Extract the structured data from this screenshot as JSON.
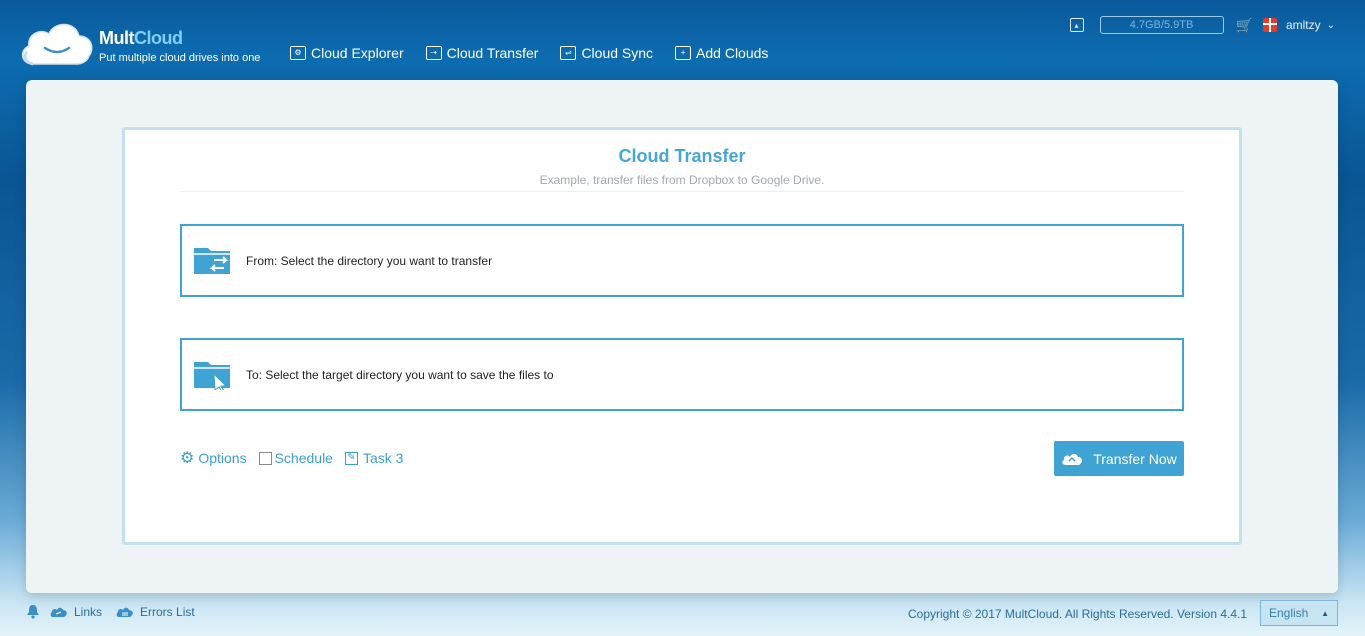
{
  "header": {
    "logo_name": "MultCloud",
    "logo_name_a": "Mult",
    "logo_name_b": "Cloud",
    "logo_tagline": "Put multiple cloud drives into one",
    "nav": [
      {
        "label": "Cloud Explorer",
        "icon": "explorer-icon"
      },
      {
        "label": "Cloud Transfer",
        "icon": "transfer-icon"
      },
      {
        "label": "Cloud Sync",
        "icon": "sync-icon"
      },
      {
        "label": "Add Clouds",
        "icon": "add-icon"
      }
    ],
    "storage": "4.7GB/5.9TB",
    "username": "amltzy"
  },
  "main": {
    "title": "Cloud Transfer",
    "subtitle": "Example, transfer files from Dropbox to Google Drive.",
    "from_text": "From: Select the directory you want to transfer",
    "to_text": "To: Select the target directory you want to save the files to",
    "options_label": "Options",
    "schedule_label": "Schedule",
    "task_label": "Task 3",
    "transfer_button": "Transfer Now"
  },
  "footer": {
    "links_label": "Links",
    "errors_label": "Errors List",
    "copyright": "Copyright © 2017 MultCloud. All Rights Reserved. Version 4.4.1",
    "language": "English"
  },
  "colors": {
    "accent": "#3fa3d3",
    "header_bg": "#0a5a9c",
    "title": "#46a6d6"
  }
}
